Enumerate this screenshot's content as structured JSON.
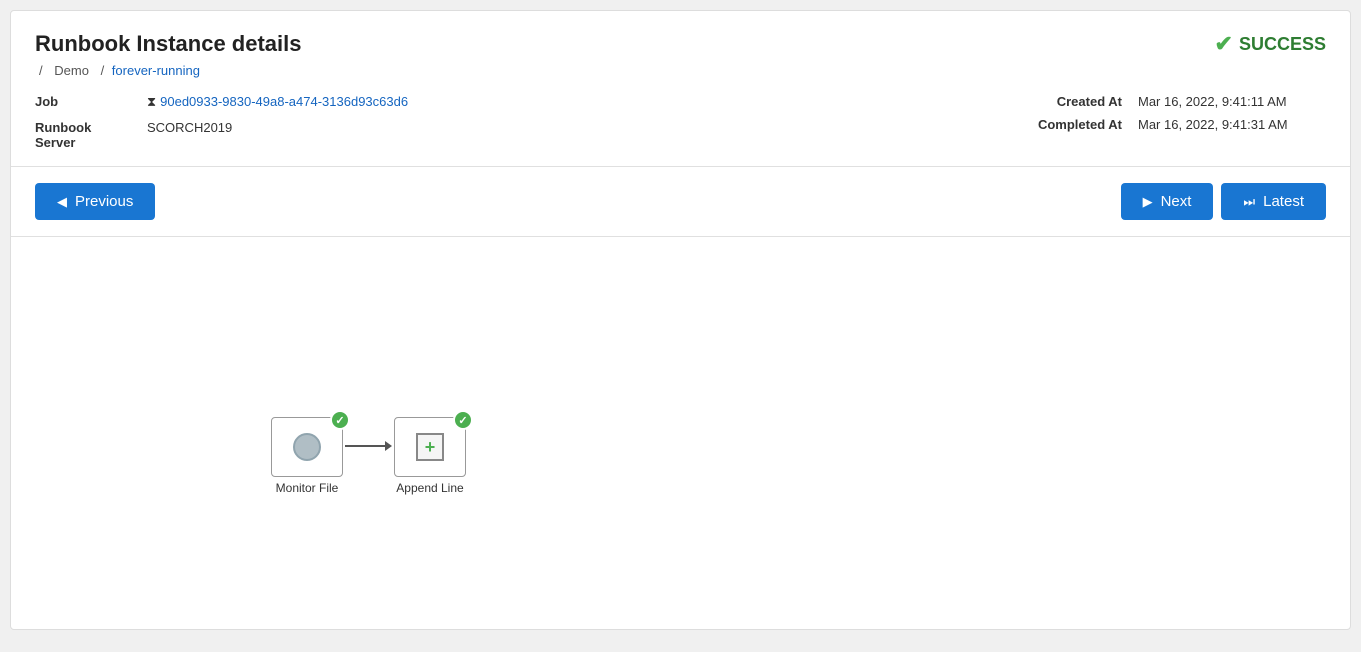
{
  "page": {
    "title": "Runbook Instance details",
    "status": "SUCCESS",
    "breadcrumb": {
      "separator": "/",
      "items": [
        {
          "label": "Demo",
          "link": false
        },
        {
          "label": "forever-running",
          "link": true
        }
      ]
    }
  },
  "metadata": {
    "job_label": "Job",
    "job_icon": "⧗",
    "job_id": "90ed0933-9830-49a8-a474-3136d93c63d6",
    "runbook_server_label": "Runbook Server",
    "runbook_server_value": "SCORCH2019",
    "created_at_label": "Created At",
    "created_at_value": "Mar 16, 2022, 9:41:11 AM",
    "completed_at_label": "Completed At",
    "completed_at_value": "Mar 16, 2022, 9:41:31 AM"
  },
  "navigation": {
    "previous_label": "Previous",
    "next_label": "Next",
    "latest_label": "Latest"
  },
  "workflow": {
    "nodes": [
      {
        "id": "monitor-file",
        "label": "Monitor File",
        "type": "monitor"
      },
      {
        "id": "append-line",
        "label": "Append Line",
        "type": "append"
      }
    ]
  }
}
